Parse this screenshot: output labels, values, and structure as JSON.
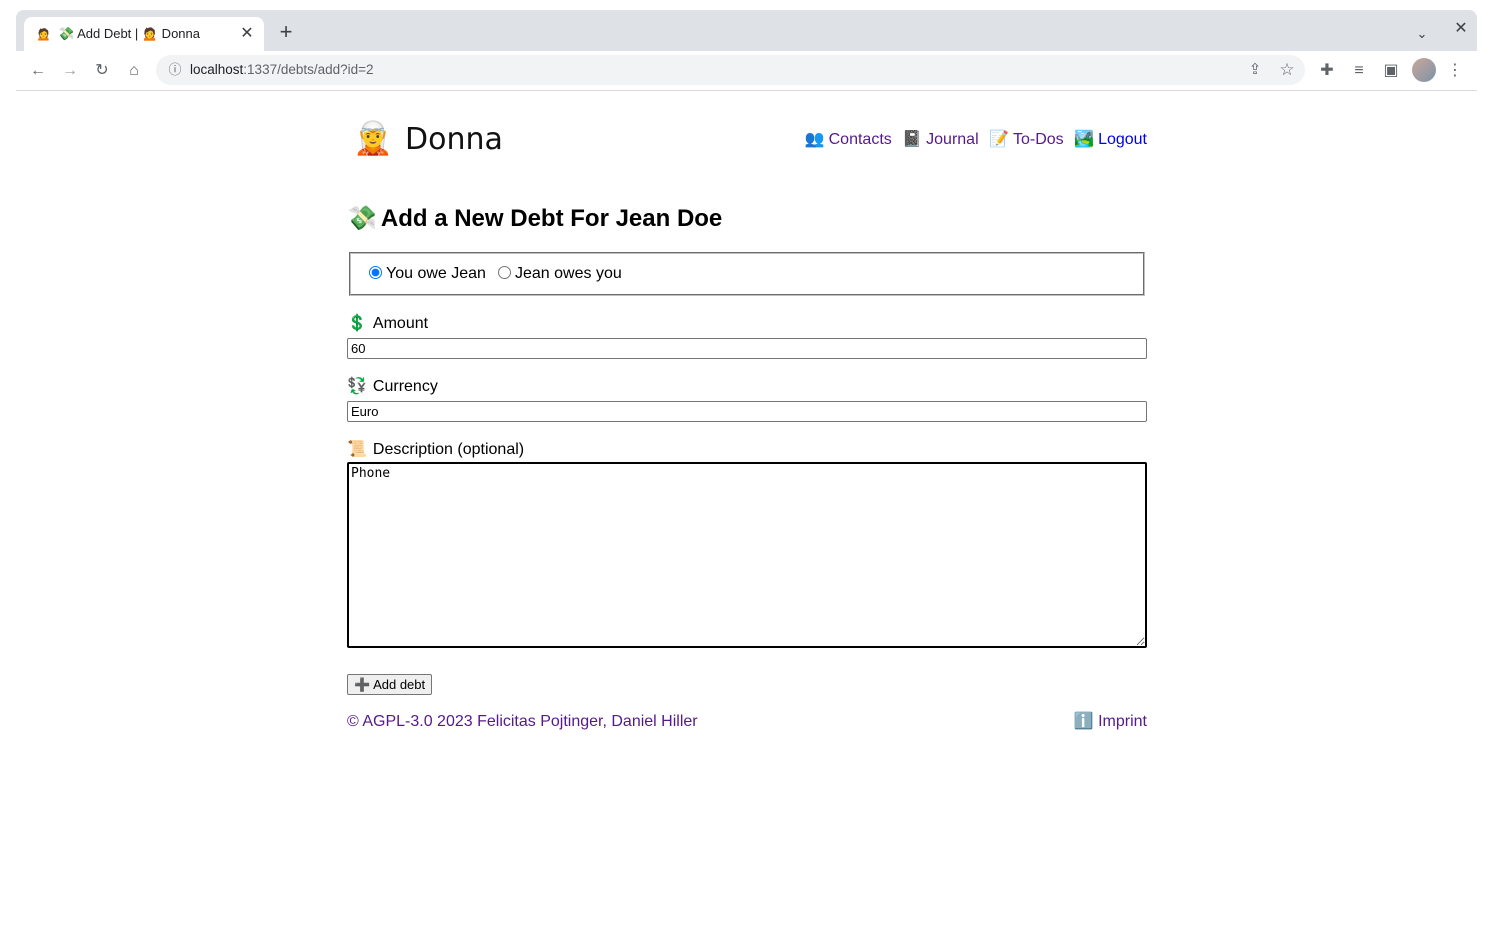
{
  "browser": {
    "tab": {
      "favicon": "🙍",
      "title": "💸 Add Debt | 🙍 Donna",
      "close_icon": "✕"
    },
    "new_tab_icon": "+",
    "tab_search_icon": "⌄",
    "window_close_icon": "✕",
    "nav": {
      "back_icon": "←",
      "forward_icon": "→",
      "reload_icon": "↻",
      "home_icon": "⌂"
    },
    "omnibox": {
      "info_icon": "ⓘ",
      "url_host": "localhost",
      "url_path": ":1337/debts/add?id=2",
      "share_icon": "⇪",
      "bookmark_icon": "☆"
    },
    "extensions_icon": "✚",
    "media_icon": "≡",
    "sidepanel_icon": "▣",
    "menu_icon": "⋮"
  },
  "site": {
    "logo_emoji": "🧝",
    "brand": "Donna",
    "nav": [
      {
        "icon": "👥",
        "label": "Contacts"
      },
      {
        "icon": "📓",
        "label": "Journal"
      },
      {
        "icon": "📝",
        "label": "To-Dos"
      },
      {
        "icon": "🏞️",
        "label": "Logout"
      }
    ]
  },
  "form": {
    "title_icon": "💸",
    "title": "Add a New Debt For Jean Doe",
    "direction": {
      "option_you_owe": "You owe Jean",
      "option_they_owe": "Jean owes you",
      "selected": "you_owe"
    },
    "amount": {
      "icon": "💲",
      "label": "Amount",
      "value": "60"
    },
    "currency": {
      "icon": "💱",
      "label": "Currency",
      "value": "Euro"
    },
    "description": {
      "icon": "📜",
      "label": "Description (optional)",
      "value": "Phone"
    },
    "submit_label": "➕ Add debt"
  },
  "footer": {
    "copyright": "© AGPL-3.0 2023 Felicitas Pojtinger, Daniel Hiller",
    "imprint_icon": "ℹ️",
    "imprint_label": "Imprint"
  }
}
